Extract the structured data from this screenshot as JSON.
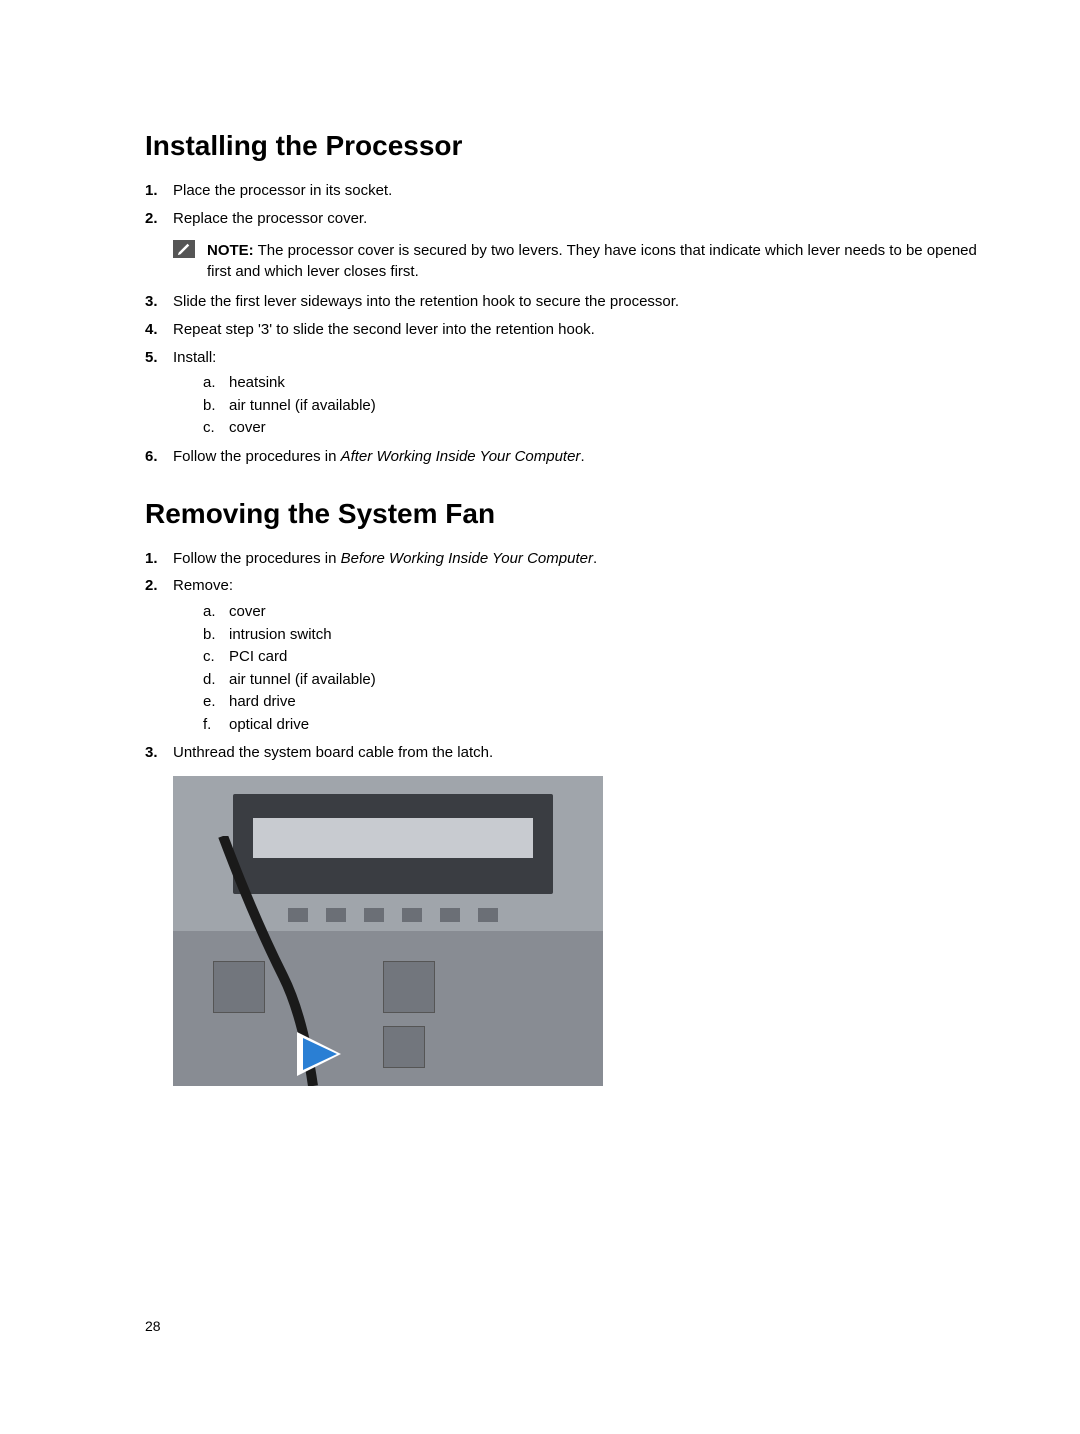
{
  "section1": {
    "heading": "Installing the Processor",
    "steps": [
      {
        "num": "1.",
        "text": "Place the processor in its socket."
      },
      {
        "num": "2.",
        "text": "Replace the processor cover.",
        "note": {
          "label": "NOTE:",
          "text": "The processor cover is secured by two levers. They have icons that indicate which lever needs to be opened first and which lever closes first."
        }
      },
      {
        "num": "3.",
        "text": "Slide the first lever sideways into the retention hook to secure the processor."
      },
      {
        "num": "4.",
        "text": "Repeat step '3' to slide the second lever into the retention hook."
      },
      {
        "num": "5.",
        "text": "Install:",
        "subitems": [
          {
            "let": "a.",
            "text": "heatsink"
          },
          {
            "let": "b.",
            "text": "air tunnel (if available)"
          },
          {
            "let": "c.",
            "text": "cover"
          }
        ]
      },
      {
        "num": "6.",
        "prefix": "Follow the procedures in ",
        "italic": "After Working Inside Your Computer",
        "suffix": "."
      }
    ]
  },
  "section2": {
    "heading": "Removing the System Fan",
    "steps": [
      {
        "num": "1.",
        "prefix": "Follow the procedures in ",
        "italic": "Before Working Inside Your Computer",
        "suffix": "."
      },
      {
        "num": "2.",
        "text": "Remove:",
        "subitems": [
          {
            "let": "a.",
            "text": "cover"
          },
          {
            "let": "b.",
            "text": "intrusion switch"
          },
          {
            "let": "c.",
            "text": "PCI card"
          },
          {
            "let": "d.",
            "text": "air tunnel (if available)"
          },
          {
            "let": "e.",
            "text": "hard drive"
          },
          {
            "let": "f.",
            "text": "optical drive"
          }
        ]
      },
      {
        "num": "3.",
        "text": "Unthread the system board cable from the latch."
      }
    ]
  },
  "pageNumber": "28"
}
